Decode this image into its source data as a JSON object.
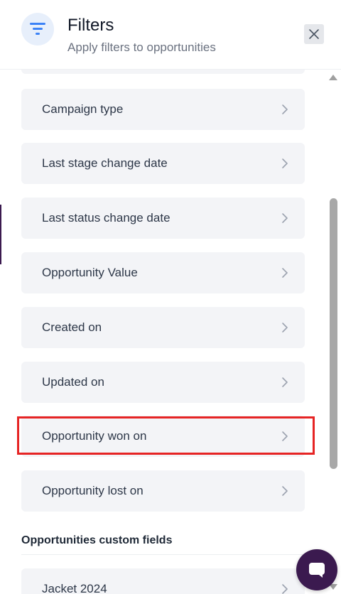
{
  "header": {
    "title": "Filters",
    "subtitle": "Apply filters to opportunities",
    "icon": "filter-icon",
    "close_icon": "close-icon"
  },
  "filter_items": [
    {
      "label": "Campaign type"
    },
    {
      "label": "Last stage change date"
    },
    {
      "label": "Last status change date"
    },
    {
      "label": "Opportunity Value"
    },
    {
      "label": "Created on"
    },
    {
      "label": "Updated on"
    },
    {
      "label": "Opportunity won on"
    },
    {
      "label": "Opportunity lost on"
    }
  ],
  "custom_fields": {
    "section_title": "Opportunities custom fields",
    "items": [
      {
        "label": "Jacket 2024"
      }
    ]
  },
  "colors": {
    "accent": "#3b82f6",
    "card_bg": "#f3f4f7",
    "highlight": "#e62424",
    "chat_bubble": "#3b1a4f"
  },
  "chat_icon": "chat-bubble-icon"
}
